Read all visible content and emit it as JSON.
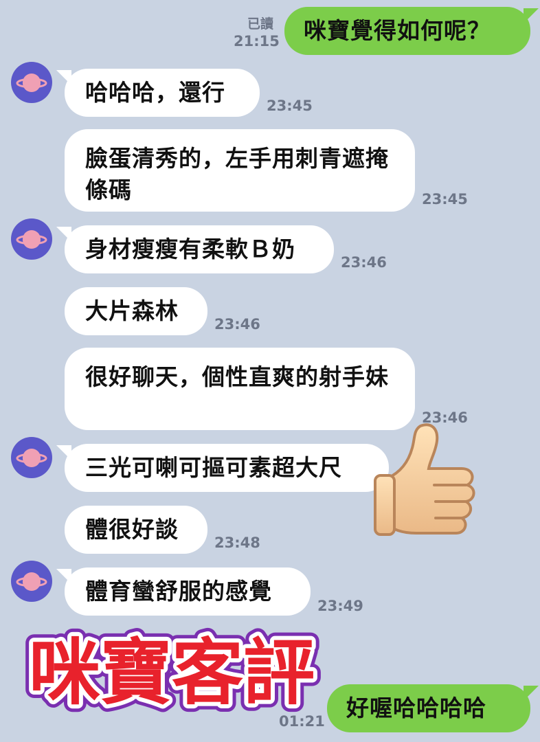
{
  "messages": [
    {
      "side": "out",
      "text": "咪寶覺得如何呢？",
      "time": "21:15",
      "read": "已讀"
    },
    {
      "side": "in",
      "avatar": true,
      "text": "哈哈哈，還行",
      "time": "23:45"
    },
    {
      "side": "in",
      "avatar": false,
      "text": "臉蛋清秀的，左手用刺青遮掩條碼",
      "time": "23:45"
    },
    {
      "side": "in",
      "avatar": true,
      "text": "身材瘦瘦有柔軟Ｂ奶",
      "time": "23:46"
    },
    {
      "side": "in",
      "avatar": false,
      "text": "大片森林",
      "time": "23:46"
    },
    {
      "side": "in",
      "avatar": false,
      "text": "很好聊天，個性直爽的射手妹",
      "time": "23:46"
    },
    {
      "side": "in",
      "avatar": true,
      "text": "三光可喇可摳可素超大尺",
      "time": ""
    },
    {
      "side": "in",
      "avatar": false,
      "text": "體很好談",
      "time": "23:48"
    },
    {
      "side": "in",
      "avatar": true,
      "text": "體育蠻舒服的感覺",
      "time": "23:49"
    },
    {
      "side": "out",
      "text": "好喔哈哈哈哈",
      "time": "01:21"
    }
  ],
  "watermark": {
    "text": "咪寶客評",
    "colors": {
      "fill": "#e8222c",
      "outline": "#ffffff",
      "glow": "#7a2fb0"
    }
  },
  "sticker": {
    "icon": "thumbs-up-icon"
  },
  "colors": {
    "background": "#c9d3e2",
    "incoming": "#ffffff",
    "outgoing": "#7ccd4a",
    "avatar": "#5b58c9",
    "planet": "#f0a0b4",
    "time": "#6d7688"
  }
}
